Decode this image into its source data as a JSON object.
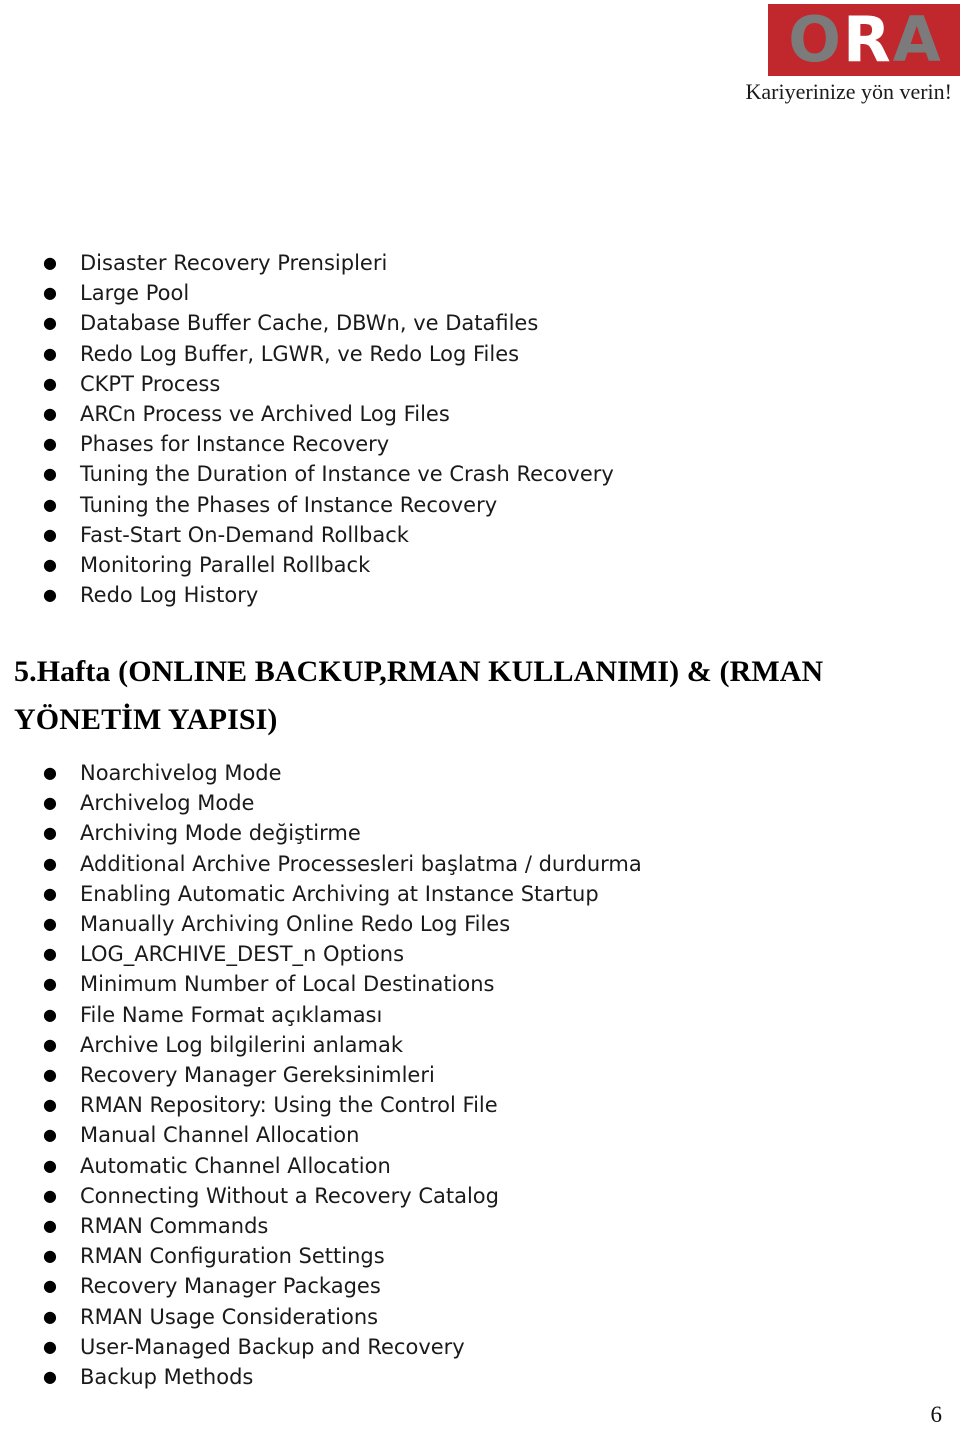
{
  "logo": {
    "letters": [
      "O",
      "R",
      "A"
    ],
    "tagline": "Kariyerinize yön verin!",
    "box_color": "#c0282d",
    "letter_gray": "#7b7b7b",
    "letter_white": "#ffffff"
  },
  "bullet_glyph": "●",
  "list_one": {
    "items": [
      "Disaster Recovery Prensipleri",
      "Large Pool",
      "Database Buffer Cache, DBWn, ve Datafiles",
      "Redo Log Buffer, LGWR, ve Redo Log Files",
      "CKPT Process",
      "ARCn Process ve Archived Log Files",
      "Phases for Instance Recovery",
      "Tuning the Duration of Instance ve Crash Recovery",
      "Tuning the Phases of Instance Recovery",
      "Fast-Start On-Demand Rollback",
      "Monitoring Parallel Rollback",
      "Redo Log History"
    ]
  },
  "heading": {
    "text": "5.Hafta (ONLINE BACKUP,RMAN KULLANIMI) & (RMAN YÖNETİM YAPISI)"
  },
  "list_two": {
    "items": [
      "Noarchivelog Mode",
      "Archivelog Mode",
      "Archiving Mode değiştirme",
      "Additional Archive Processesleri başlatma / durdurma",
      "Enabling Automatic Archiving at Instance Startup",
      "Manually Archiving Online Redo Log Files",
      "LOG_ARCHIVE_DEST_n Options",
      "Minimum Number of Local Destinations",
      "File Name Format açıklaması",
      "Archive Log bilgilerini anlamak",
      "Recovery Manager Gereksinimleri",
      "RMAN Repository: Using the Control File",
      "Manual Channel Allocation",
      "Automatic Channel Allocation",
      "Connecting Without a Recovery Catalog",
      "RMAN Commands",
      "RMAN Configuration Settings",
      "Recovery Manager Packages",
      "RMAN Usage Considerations",
      "User-Managed Backup and Recovery",
      "Backup Methods"
    ]
  },
  "footer": {
    "page_number": "6"
  }
}
